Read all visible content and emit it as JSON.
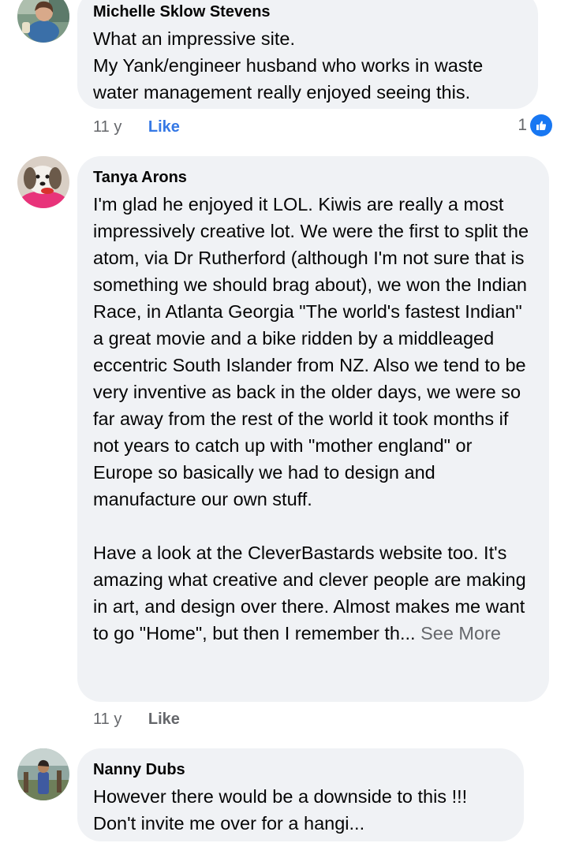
{
  "comments": [
    {
      "author": "Michelle Sklow Stevens",
      "text": "What an impressive site.\nMy Yank/engineer husband who works in waste water management really enjoyed seeing this.",
      "time": "11 y",
      "like_label": "Like",
      "reaction_count": "1"
    },
    {
      "author": "Tanya Arons",
      "text": "I'm glad he enjoyed it LOL.  Kiwis are really a most impressively creative lot.  We were the first to split the atom, via Dr Rutherford (although I'm not sure that is something we should brag about), we won the Indian Race, in Atlanta Georgia  \"The world's fastest Indian\"  a great movie and a bike ridden by a middleaged eccentric South Islander from NZ.  Also we tend to be very inventive as back in the older days, we were so far away from the rest of the world it took months if not years to catch up with \"mother england\" or Europe so basically we had to design and manufacture our own stuff.\n\nHave a look at the CleverBastards website too. It's amazing what creative and clever people are making in art, and design over there.  Almost makes me want to go \"Home\", but then I remember th... ",
      "see_more": "See More",
      "time": "11 y",
      "like_label": "Like"
    },
    {
      "author": "Nanny Dubs",
      "text": "However there would be a downside to this !!!\nDon't invite me over for a hangi...",
      "time": "",
      "like_label": ""
    }
  ],
  "colors": {
    "bubble_bg": "#f0f2f5",
    "like_active": "#3578e5",
    "secondary_text": "#65676b",
    "reaction_blue": "#1877f2"
  }
}
